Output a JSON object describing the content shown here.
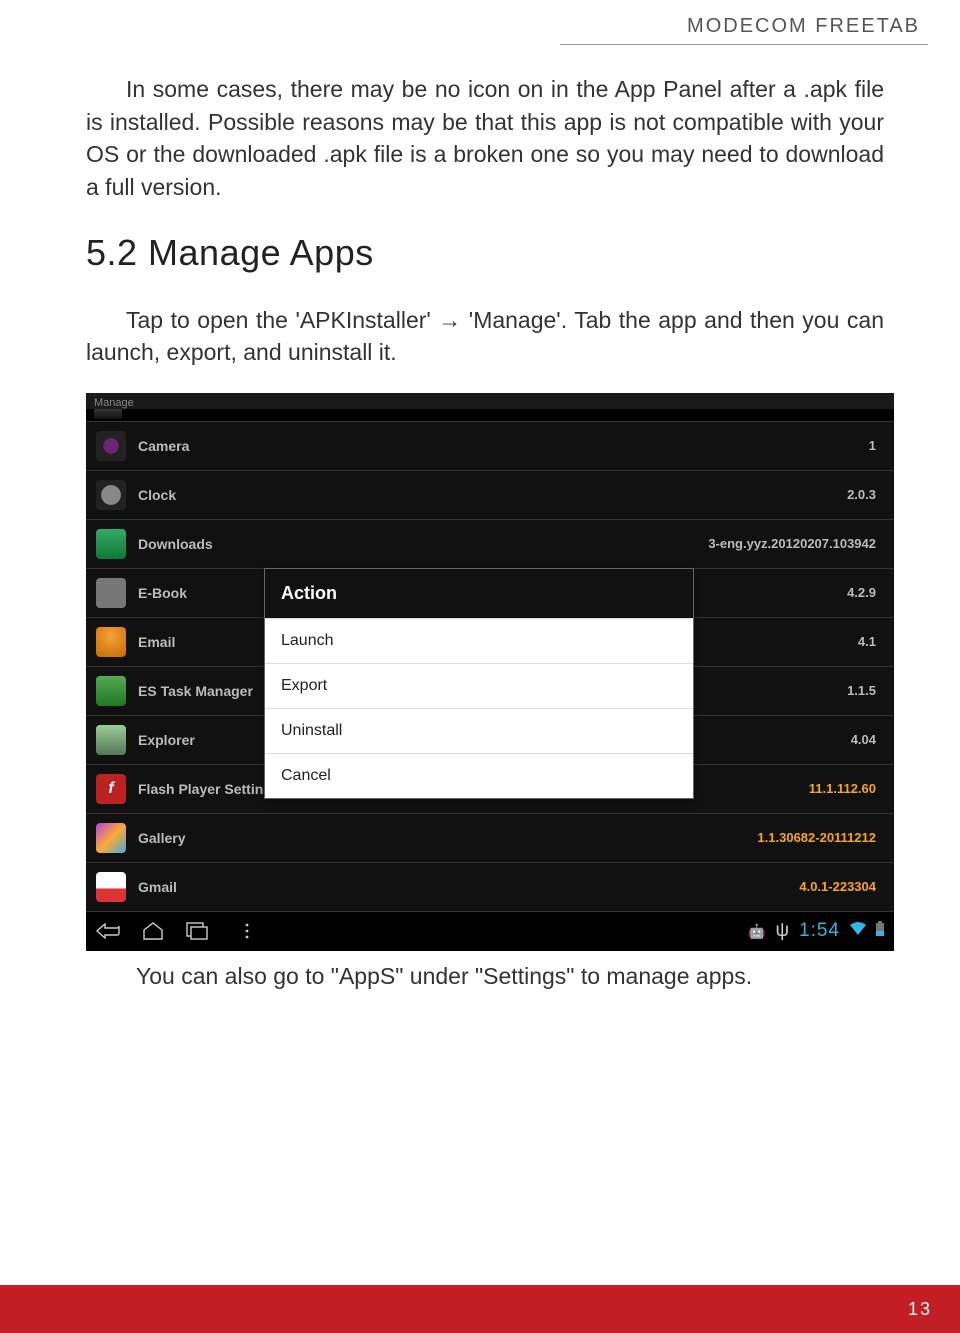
{
  "header": {
    "brand": "MODECOM FREETAB"
  },
  "body": {
    "para1": "In some cases, there may be no icon on in the App Panel after a .apk file is installed. Possible reasons may be that this app is not compatible with your OS or the downloaded .apk file is a broken one so you may need to download a full version.",
    "section_heading": "5.2 Manage Apps",
    "para2": "Tap to open the 'APKInstaller' → 'Manage'. Tab the app and then you can launch, export, and uninstall it.",
    "caption": "You can also go to \"AppS\" under \"Settings\" to manage apps."
  },
  "screenshot": {
    "title": "Manage",
    "apps": [
      {
        "name": "Camera",
        "version": "1"
      },
      {
        "name": "Clock",
        "version": "2.0.3"
      },
      {
        "name": "Downloads",
        "version": "3-eng.yyz.20120207.103942"
      },
      {
        "name": "E-Book",
        "version": "4.2.9"
      },
      {
        "name": "Email",
        "version": "4.1"
      },
      {
        "name": "ES Task Manager",
        "version": "1.1.5"
      },
      {
        "name": "Explorer",
        "version": "4.04"
      },
      {
        "name": "Flash Player Settings",
        "version": "11.1.112.60",
        "orange": true
      },
      {
        "name": "Gallery",
        "version": "1.1.30682-20111212",
        "orange": true
      },
      {
        "name": "Gmail",
        "version": "4.0.1-223304",
        "orange": true
      }
    ],
    "dialog": {
      "title": "Action",
      "items": [
        "Launch",
        "Export",
        "Uninstall",
        "Cancel"
      ]
    },
    "nav": {
      "time": "1:54"
    }
  },
  "footer": {
    "page": "13"
  }
}
